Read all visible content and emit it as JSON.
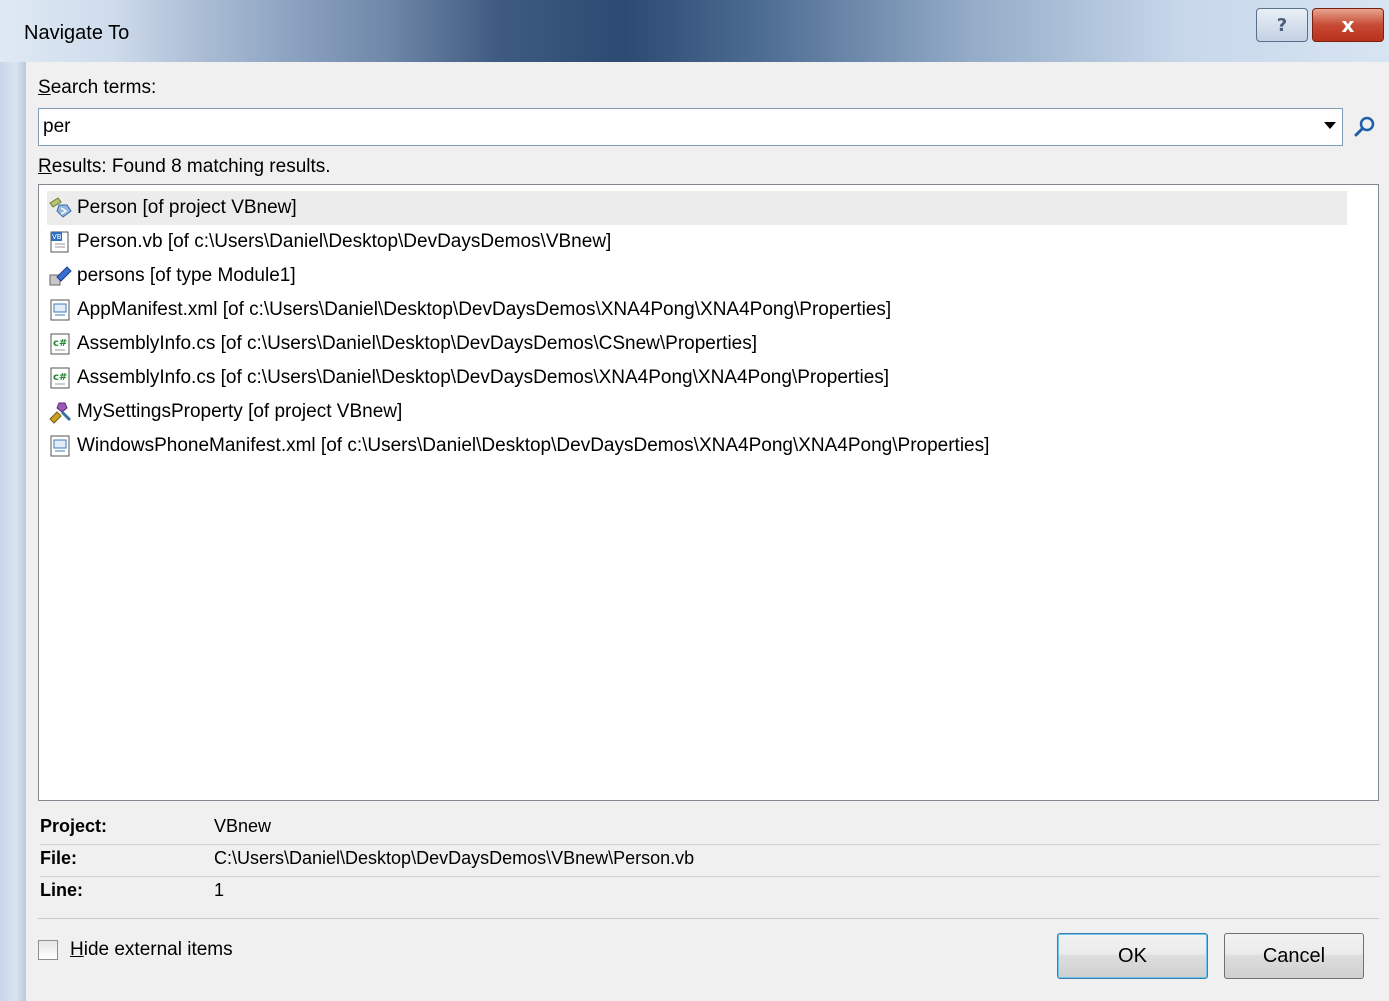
{
  "window": {
    "title": "Navigate To",
    "help_label": "?",
    "close_label": "x"
  },
  "search": {
    "label_accel": "S",
    "label_rest": "earch terms:",
    "value": "per"
  },
  "results": {
    "label_accel": "R",
    "label_rest": "esults: Found 8 matching results.",
    "items": [
      {
        "text": "Person [of project VBnew]",
        "icon": "class-icon"
      },
      {
        "text": "Person.vb [of c:\\Users\\Daniel\\Desktop\\DevDaysDemos\\VBnew]",
        "icon": "vb-file-icon"
      },
      {
        "text": "persons [of type Module1]",
        "icon": "field-icon"
      },
      {
        "text": "AppManifest.xml [of c:\\Users\\Daniel\\Desktop\\DevDaysDemos\\XNA4Pong\\XNA4Pong\\Properties]",
        "icon": "xml-file-icon"
      },
      {
        "text": "AssemblyInfo.cs [of c:\\Users\\Daniel\\Desktop\\DevDaysDemos\\CSnew\\Properties]",
        "icon": "cs-file-icon"
      },
      {
        "text": "AssemblyInfo.cs [of c:\\Users\\Daniel\\Desktop\\DevDaysDemos\\XNA4Pong\\XNA4Pong\\Properties]",
        "icon": "cs-file-icon"
      },
      {
        "text": "MySettingsProperty [of project VBnew]",
        "icon": "module-icon"
      },
      {
        "text": "WindowsPhoneManifest.xml [of c:\\Users\\Daniel\\Desktop\\DevDaysDemos\\XNA4Pong\\XNA4Pong\\Properties]",
        "icon": "xml-file-icon"
      }
    ]
  },
  "details": {
    "project_label": "Project:",
    "project_value": "VBnew",
    "file_label": "File:",
    "file_value": "C:\\Users\\Daniel\\Desktop\\DevDaysDemos\\VBnew\\Person.vb",
    "line_label": "Line:",
    "line_value": "1"
  },
  "footer": {
    "hide_accel": "H",
    "hide_rest": "ide external items",
    "ok_label": "OK",
    "cancel_label": "Cancel"
  }
}
